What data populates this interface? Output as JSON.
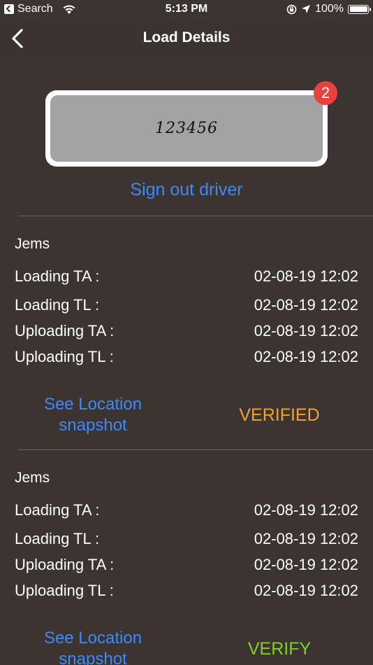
{
  "status_bar": {
    "back_app": "Search",
    "time": "5:13 PM",
    "battery_pct": "100%"
  },
  "nav": {
    "title": "Load Details"
  },
  "signature": {
    "text": "123456",
    "badge_count": "2"
  },
  "sign_out_label": "Sign out driver",
  "entries": [
    {
      "driver": "Jems",
      "rows": [
        {
          "label": "Loading TA :",
          "value": "02-08-19 12:02"
        },
        {
          "label": "Loading TL :",
          "value": "02-08-19 12:02"
        },
        {
          "label": "Uploading TA :",
          "value": "02-08-19 12:02"
        },
        {
          "label": "Uploading TL :",
          "value": "02-08-19 12:02"
        }
      ],
      "location_line1": "See Location",
      "location_line2": "snapshot",
      "status": "VERIFIED"
    },
    {
      "driver": "Jems",
      "rows": [
        {
          "label": "Loading TA :",
          "value": "02-08-19 12:02"
        },
        {
          "label": "Loading TL :",
          "value": "02-08-19 12:02"
        },
        {
          "label": "Uploading TA :",
          "value": "02-08-19 12:02"
        },
        {
          "label": "Uploading TL :",
          "value": "02-08-19 12:02"
        }
      ],
      "location_line1": "See Location",
      "location_line2": "snapshot",
      "status": "VERIFY"
    }
  ],
  "colors": {
    "background": "#3c3430",
    "link": "#3d8af7",
    "verified": "#f2a02e",
    "verify": "#7ed321",
    "badge": "#e9423d"
  }
}
